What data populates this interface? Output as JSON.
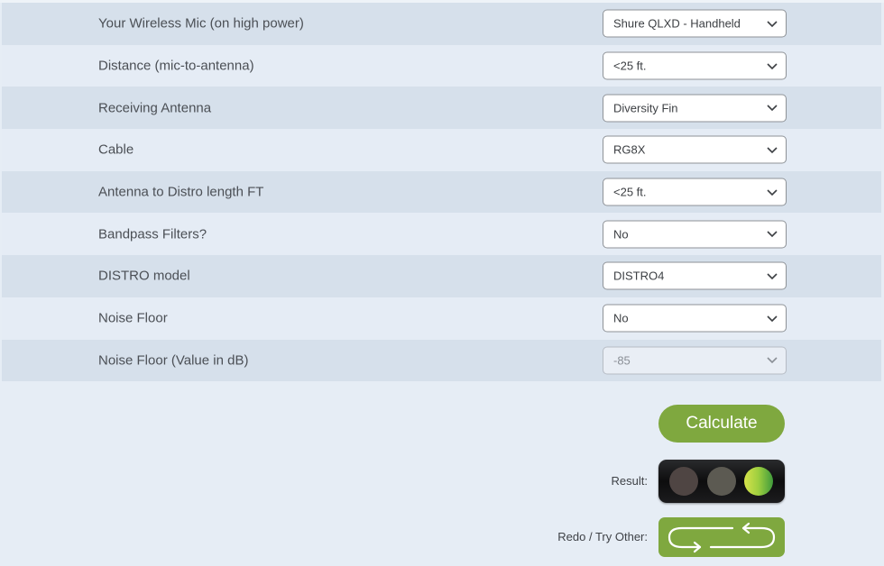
{
  "form": {
    "rows": [
      {
        "label": "Your Wireless Mic (on high power)",
        "value": "Shure QLXD - Handheld",
        "disabled": false
      },
      {
        "label": "Distance (mic-to-antenna)",
        "value": "<25 ft.",
        "disabled": false
      },
      {
        "label": "Receiving Antenna",
        "value": "Diversity Fin",
        "disabled": false
      },
      {
        "label": "Cable",
        "value": "RG8X",
        "disabled": false
      },
      {
        "label": "Antenna to Distro length FT",
        "value": "<25 ft.",
        "disabled": false
      },
      {
        "label": "Bandpass Filters?",
        "value": "No",
        "disabled": false
      },
      {
        "label": "DISTRO model",
        "value": "DISTRO4",
        "disabled": false
      },
      {
        "label": "Noise Floor",
        "value": "No",
        "disabled": false
      },
      {
        "label": "Noise Floor (Value in dB)",
        "value": "-85",
        "disabled": true
      }
    ]
  },
  "actions": {
    "calculate_label": "Calculate",
    "result_label": "Result:",
    "result_state": "green",
    "redo_label": "Redo / Try Other:",
    "redo_icon": "loop-arrows-icon"
  },
  "colors": {
    "accent_green": "#7fa83f",
    "row_dark": "#d6e0eb",
    "row_light": "#e5ecf5"
  }
}
